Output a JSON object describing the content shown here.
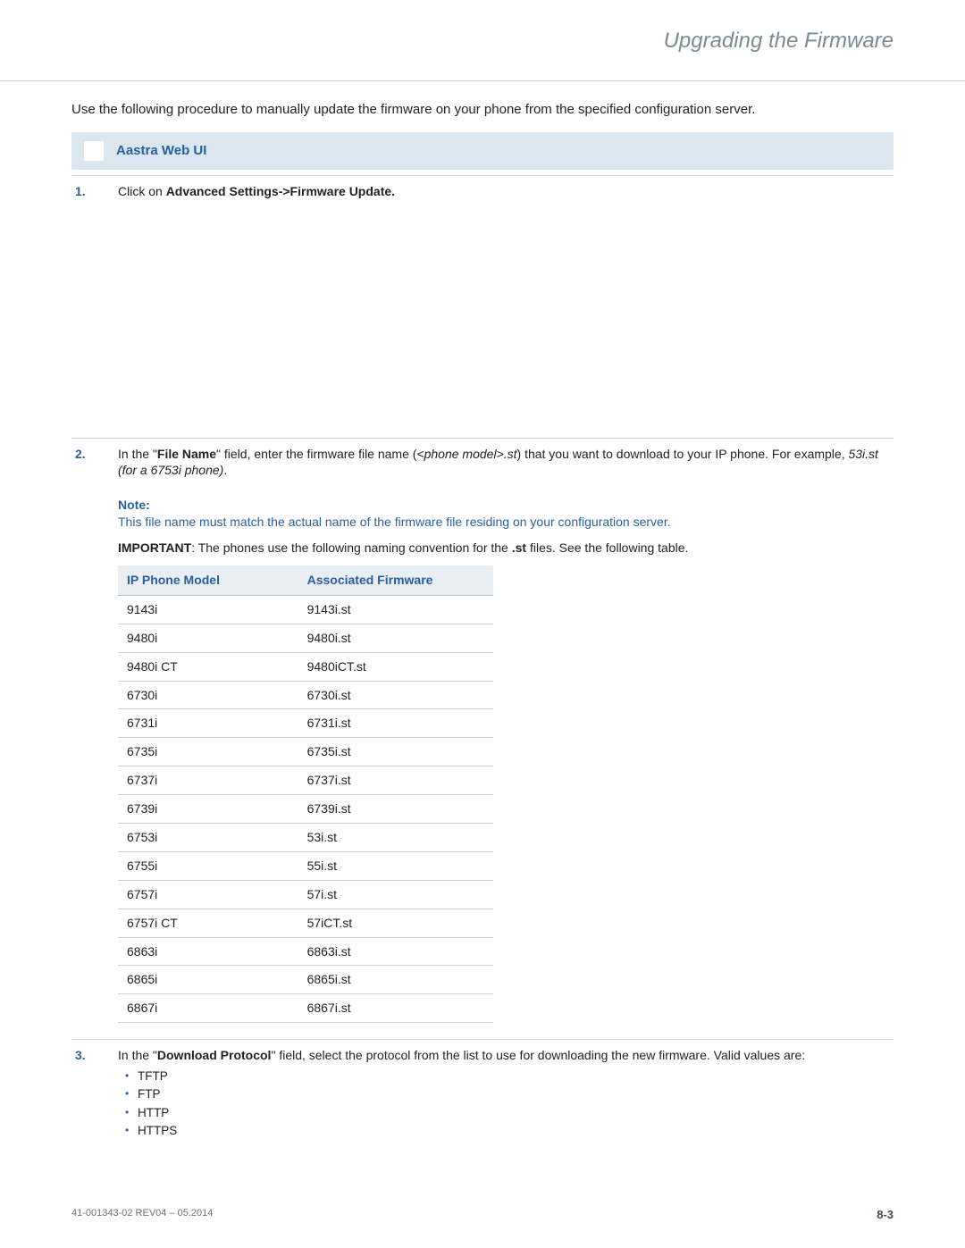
{
  "header": {
    "title": "Upgrading the Firmware"
  },
  "intro": "Use the following procedure to manually update the firmware on your phone from the specified configuration server.",
  "webui": {
    "label": "Aastra Web UI"
  },
  "step1": {
    "num": "1.",
    "prefix": "Click on ",
    "bold": "Advanced Settings->Firmware Update."
  },
  "step2": {
    "num": "2.",
    "p1": "In the \"",
    "b1": "File Name",
    "p2": "\" field, enter the firmware file name (",
    "i1": "<phone model>.st",
    "p3": ") that you want to download to your IP phone. For example, ",
    "i2": "53i.st (for a 6753i phone)",
    "p4": "."
  },
  "note": {
    "label": "Note:",
    "text": "This file name must match the actual name of the firmware file residing on your configuration server."
  },
  "important": {
    "b": "IMPORTANT",
    "t1": ": The phones use the following naming convention for the ",
    "bext": ".st",
    "t2": " files. See the following table."
  },
  "table": {
    "h1": "IP Phone Model",
    "h2": "Associated Firmware",
    "rows": [
      {
        "m": "9143i",
        "f": "9143i.st"
      },
      {
        "m": "9480i",
        "f": "9480i.st"
      },
      {
        "m": "9480i CT",
        "f": "9480iCT.st"
      },
      {
        "m": "6730i",
        "f": "6730i.st"
      },
      {
        "m": "6731i",
        "f": "6731i.st"
      },
      {
        "m": "6735i",
        "f": "6735i.st"
      },
      {
        "m": "6737i",
        "f": "6737i.st"
      },
      {
        "m": "6739i",
        "f": "6739i.st"
      },
      {
        "m": "6753i",
        "f": "53i.st"
      },
      {
        "m": "6755i",
        "f": "55i.st"
      },
      {
        "m": "6757i",
        "f": "57i.st"
      },
      {
        "m": "6757i CT",
        "f": "57iCT.st"
      },
      {
        "m": "6863i",
        "f": "6863i.st"
      },
      {
        "m": "6865i",
        "f": "6865i.st"
      },
      {
        "m": "6867i",
        "f": "6867i.st"
      }
    ]
  },
  "step3": {
    "num": "3.",
    "p1": "In the \"",
    "b1": "Download Protocol",
    "p2": "\" field, select the protocol from the list to use for downloading the new firmware. Valid values are:",
    "protocols": [
      "TFTP",
      "FTP",
      "HTTP",
      "HTTPS"
    ]
  },
  "footer": {
    "docref": "41-001343-02 REV04 – 05.2014",
    "pagenum": "8-3"
  }
}
